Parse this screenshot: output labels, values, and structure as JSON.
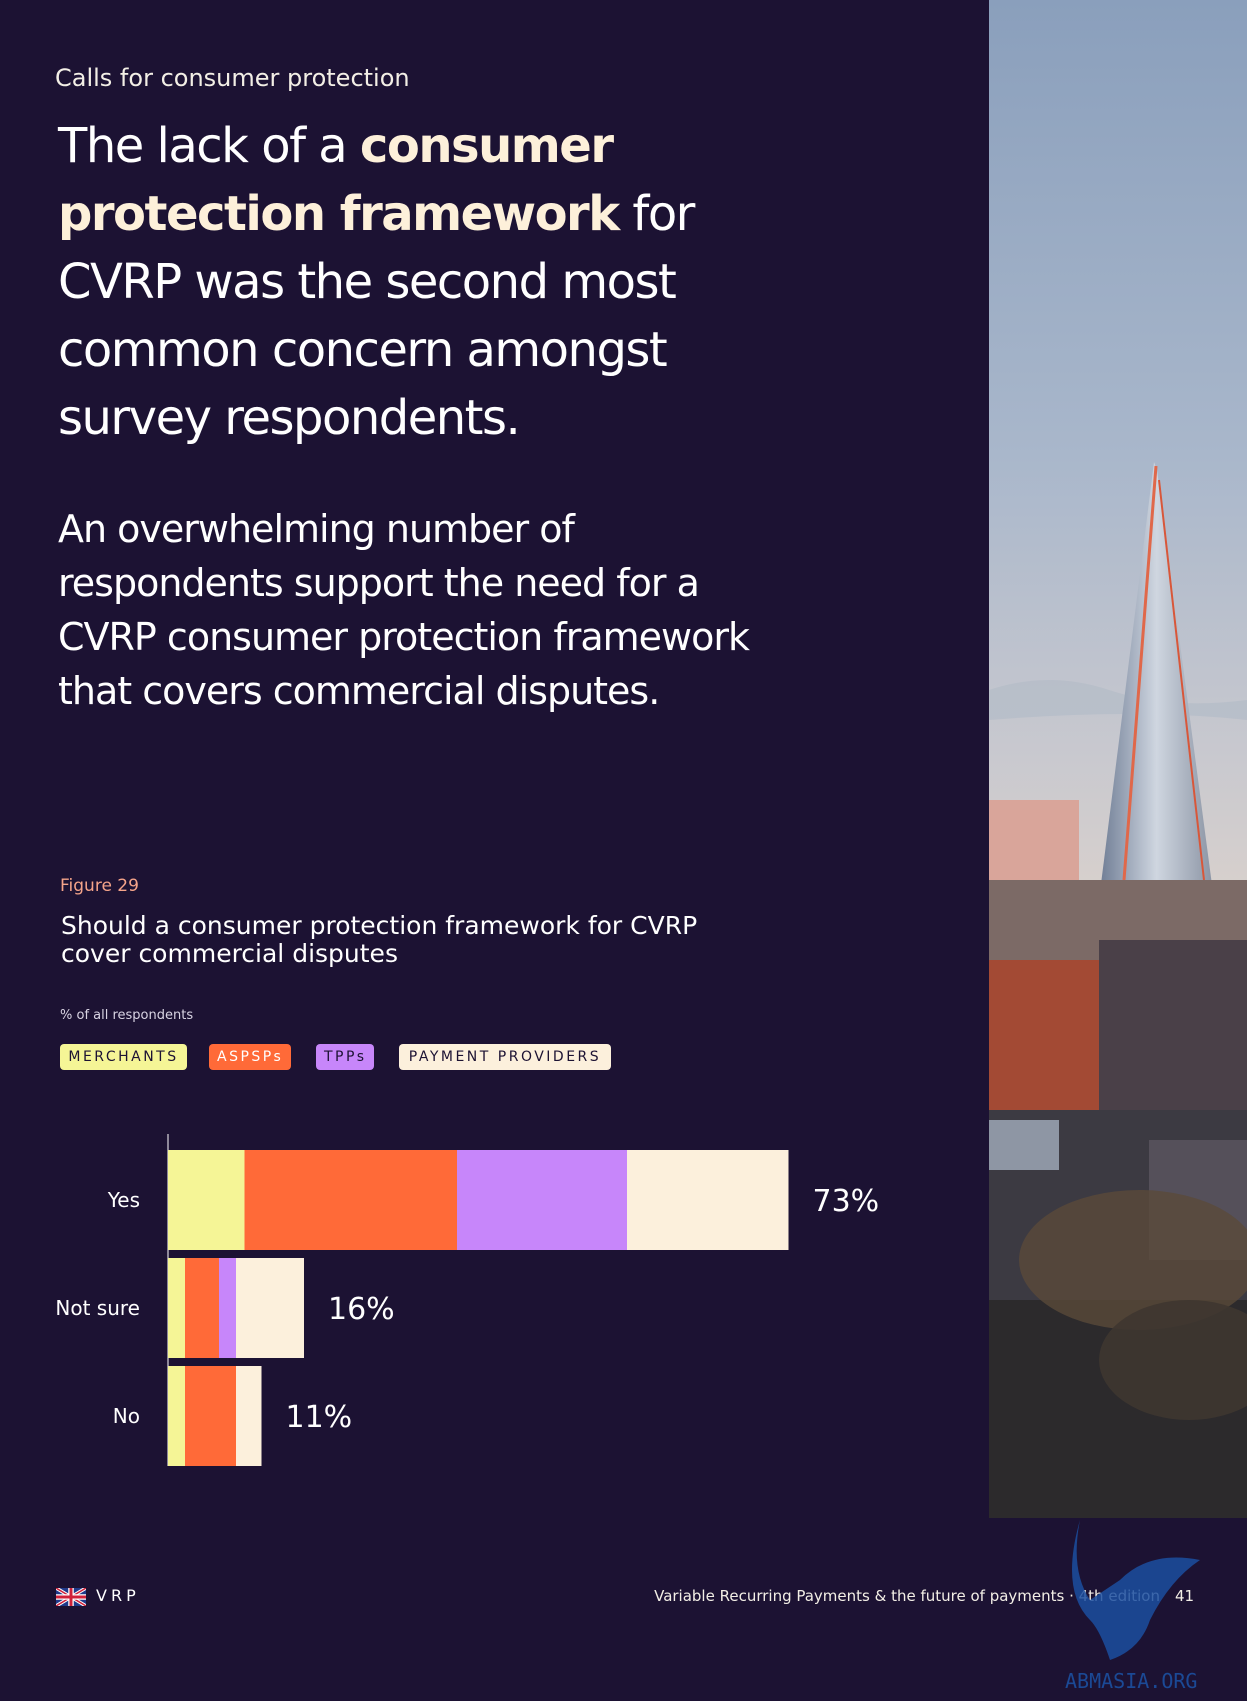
{
  "section": {
    "kicker": "Calls for consumer protection"
  },
  "headline": {
    "part1": "The lack of a ",
    "bold": "consumer protection framework",
    "part2": " for CVRP was the second most common concern amongst survey respondents."
  },
  "subhead": "An overwhelming number of respondents support the need for a CVRP consumer protection framework that covers commercial disputes.",
  "figure": {
    "label": "Figure 29",
    "title": "Should a consumer protection framework for CVRP cover commercial disputes",
    "unit_note": "% of all respondents"
  },
  "chart_data": {
    "type": "bar",
    "orientation": "horizontal",
    "stacked": true,
    "categories": [
      "Yes",
      "Not sure",
      "No"
    ],
    "series": [
      {
        "name": "MERCHANTS",
        "color": "#f5f596",
        "values": [
          9,
          2,
          2
        ]
      },
      {
        "name": "ASPSPs",
        "color": "#ff6a38",
        "values": [
          25,
          4,
          6
        ]
      },
      {
        "name": "TPPs",
        "color": "#c786fa",
        "values": [
          20,
          2,
          0
        ]
      },
      {
        "name": "PAYMENT PROVIDERS",
        "color": "#fcf0dc",
        "values": [
          19,
          8,
          3
        ]
      }
    ],
    "totals": [
      73,
      16,
      11
    ],
    "total_labels": [
      "73%",
      "16%",
      "11%"
    ],
    "legend_position": "top-left",
    "grid": false
  },
  "footer": {
    "brand": "VRP",
    "title": "Variable Recurring Payments & the future of payments · 4th edition",
    "page": "41"
  },
  "watermark": "ABMASIA.ORG",
  "colors": {
    "background": "#1c1233",
    "figure_label": "#f5a48a"
  }
}
